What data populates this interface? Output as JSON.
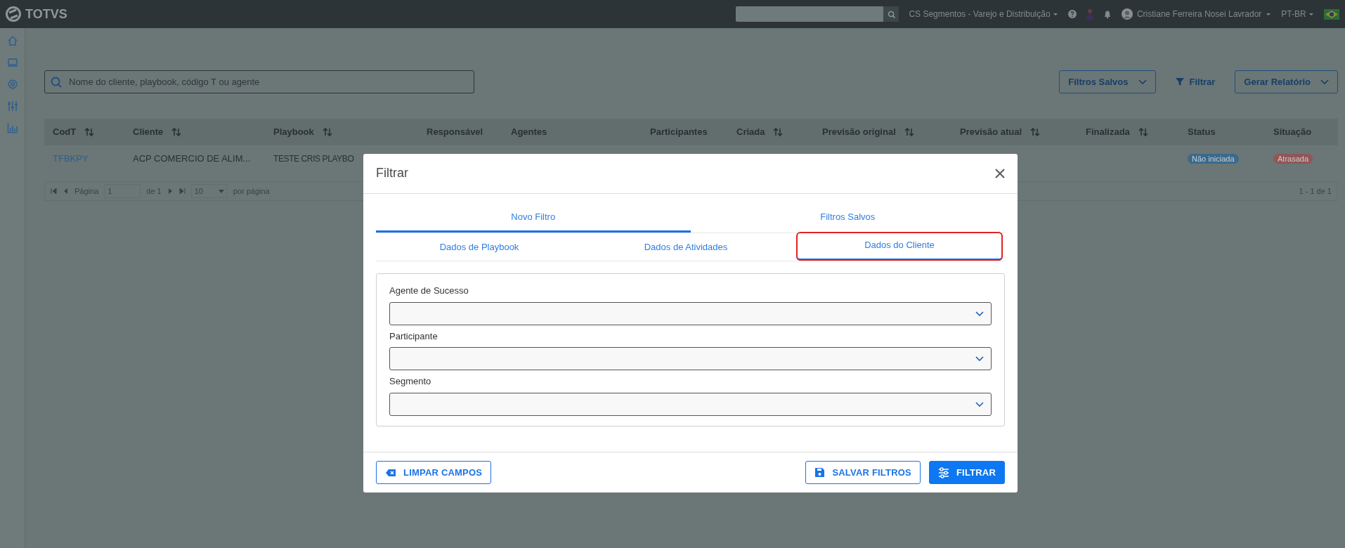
{
  "topbar": {
    "logo": "TOTVS",
    "context": "CS Segmentos - Varejo e Distribuição",
    "user": "Cristiane Ferreira Nosei Lavrador",
    "language": "PT-BR"
  },
  "search": {
    "placeholder": "Nome do cliente, playbook, código T ou agente"
  },
  "toolbar": {
    "saved_filters": "Filtros Salvos",
    "filter": "Filtrar",
    "report": "Gerar Relatório"
  },
  "table": {
    "columns": [
      {
        "label": "CodT",
        "sortable": true
      },
      {
        "label": "Cliente",
        "sortable": true
      },
      {
        "label": "Playbook",
        "sortable": true
      },
      {
        "label": "Responsável",
        "sortable": false
      },
      {
        "label": "Agentes",
        "sortable": false
      },
      {
        "label": "Participantes",
        "sortable": false
      },
      {
        "label": "Criada",
        "sortable": true
      },
      {
        "label": "Previsão original",
        "sortable": true
      },
      {
        "label": "Previsão atual",
        "sortable": true
      },
      {
        "label": "Finalizada",
        "sortable": true
      },
      {
        "label": "Status",
        "sortable": false
      },
      {
        "label": "Situação",
        "sortable": false
      }
    ],
    "rows": [
      {
        "codt": "TFBKPY",
        "cliente": "ACP COMERCIO DE ALIM...",
        "playbook": "TESTE CRIS PLAYBO",
        "status": {
          "text": "Não iniciada",
          "color": "#3a6a8c"
        },
        "situacao": {
          "text": "Atrasada",
          "color": "#925656"
        }
      }
    ]
  },
  "pagination": {
    "page_label": "Página",
    "page": "1",
    "of": "de 1",
    "per_page": "10",
    "per_page_label": "por página",
    "summary": "1 - 1 de 1"
  },
  "modal": {
    "title": "Filtrar",
    "tabs": [
      {
        "label": "Novo Filtro",
        "selected": true
      },
      {
        "label": "Filtros Salvos",
        "selected": false
      }
    ],
    "subtabs": [
      {
        "label": "Dados de Playbook",
        "selected": false,
        "highlighted": false
      },
      {
        "label": "Dados de Atividades",
        "selected": false,
        "highlighted": false
      },
      {
        "label": "Dados do Cliente",
        "selected": true,
        "highlighted": true
      }
    ],
    "fields": [
      {
        "label": "Agente de Sucesso"
      },
      {
        "label": "Participante"
      },
      {
        "label": "Segmento"
      }
    ],
    "buttons": [
      {
        "label": "LIMPAR CAMPOS",
        "kind": "outline"
      },
      {
        "label": "SALVAR FILTROS",
        "kind": "outline"
      },
      {
        "label": "FILTRAR",
        "kind": "primary"
      }
    ]
  }
}
